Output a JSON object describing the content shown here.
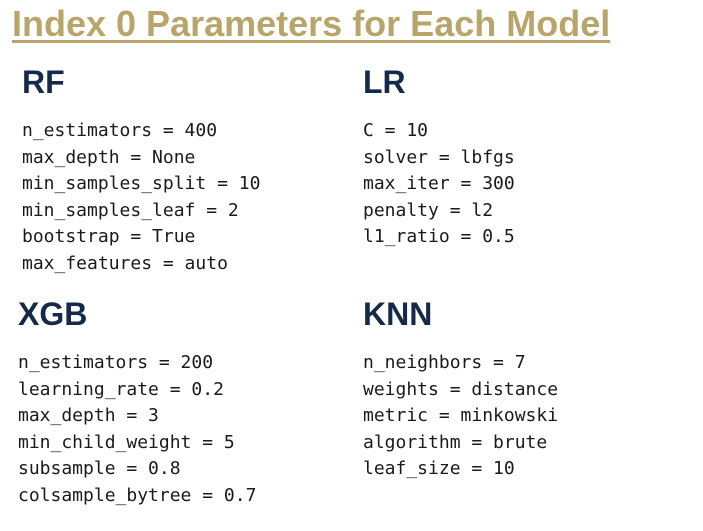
{
  "page": {
    "title": "Index 0 Parameters for Each Model"
  },
  "models": {
    "rf": {
      "name": "RF",
      "params": [
        "n_estimators = 400",
        "max_depth = None",
        "min_samples_split = 10",
        "min_samples_leaf = 2",
        "bootstrap = True",
        "max_features = auto"
      ]
    },
    "lr": {
      "name": "LR",
      "params": [
        "C = 10",
        "solver = lbfgs",
        "max_iter = 300",
        "penalty = l2",
        "l1_ratio = 0.5"
      ]
    },
    "xgb": {
      "name": "XGB",
      "params": [
        "n_estimators = 200",
        "learning_rate = 0.2",
        "max_depth = 3",
        "min_child_weight = 5",
        "subsample = 0.8",
        "colsample_bytree = 0.7"
      ]
    },
    "knn": {
      "name": "KNN",
      "params": [
        "n_neighbors = 7",
        "weights = distance",
        "metric = minkowski",
        "algorithm = brute",
        "leaf_size = 10"
      ]
    }
  },
  "colors": {
    "title": "#b7a56a",
    "heading": "#152a4a",
    "text": "#1a1a1a"
  }
}
